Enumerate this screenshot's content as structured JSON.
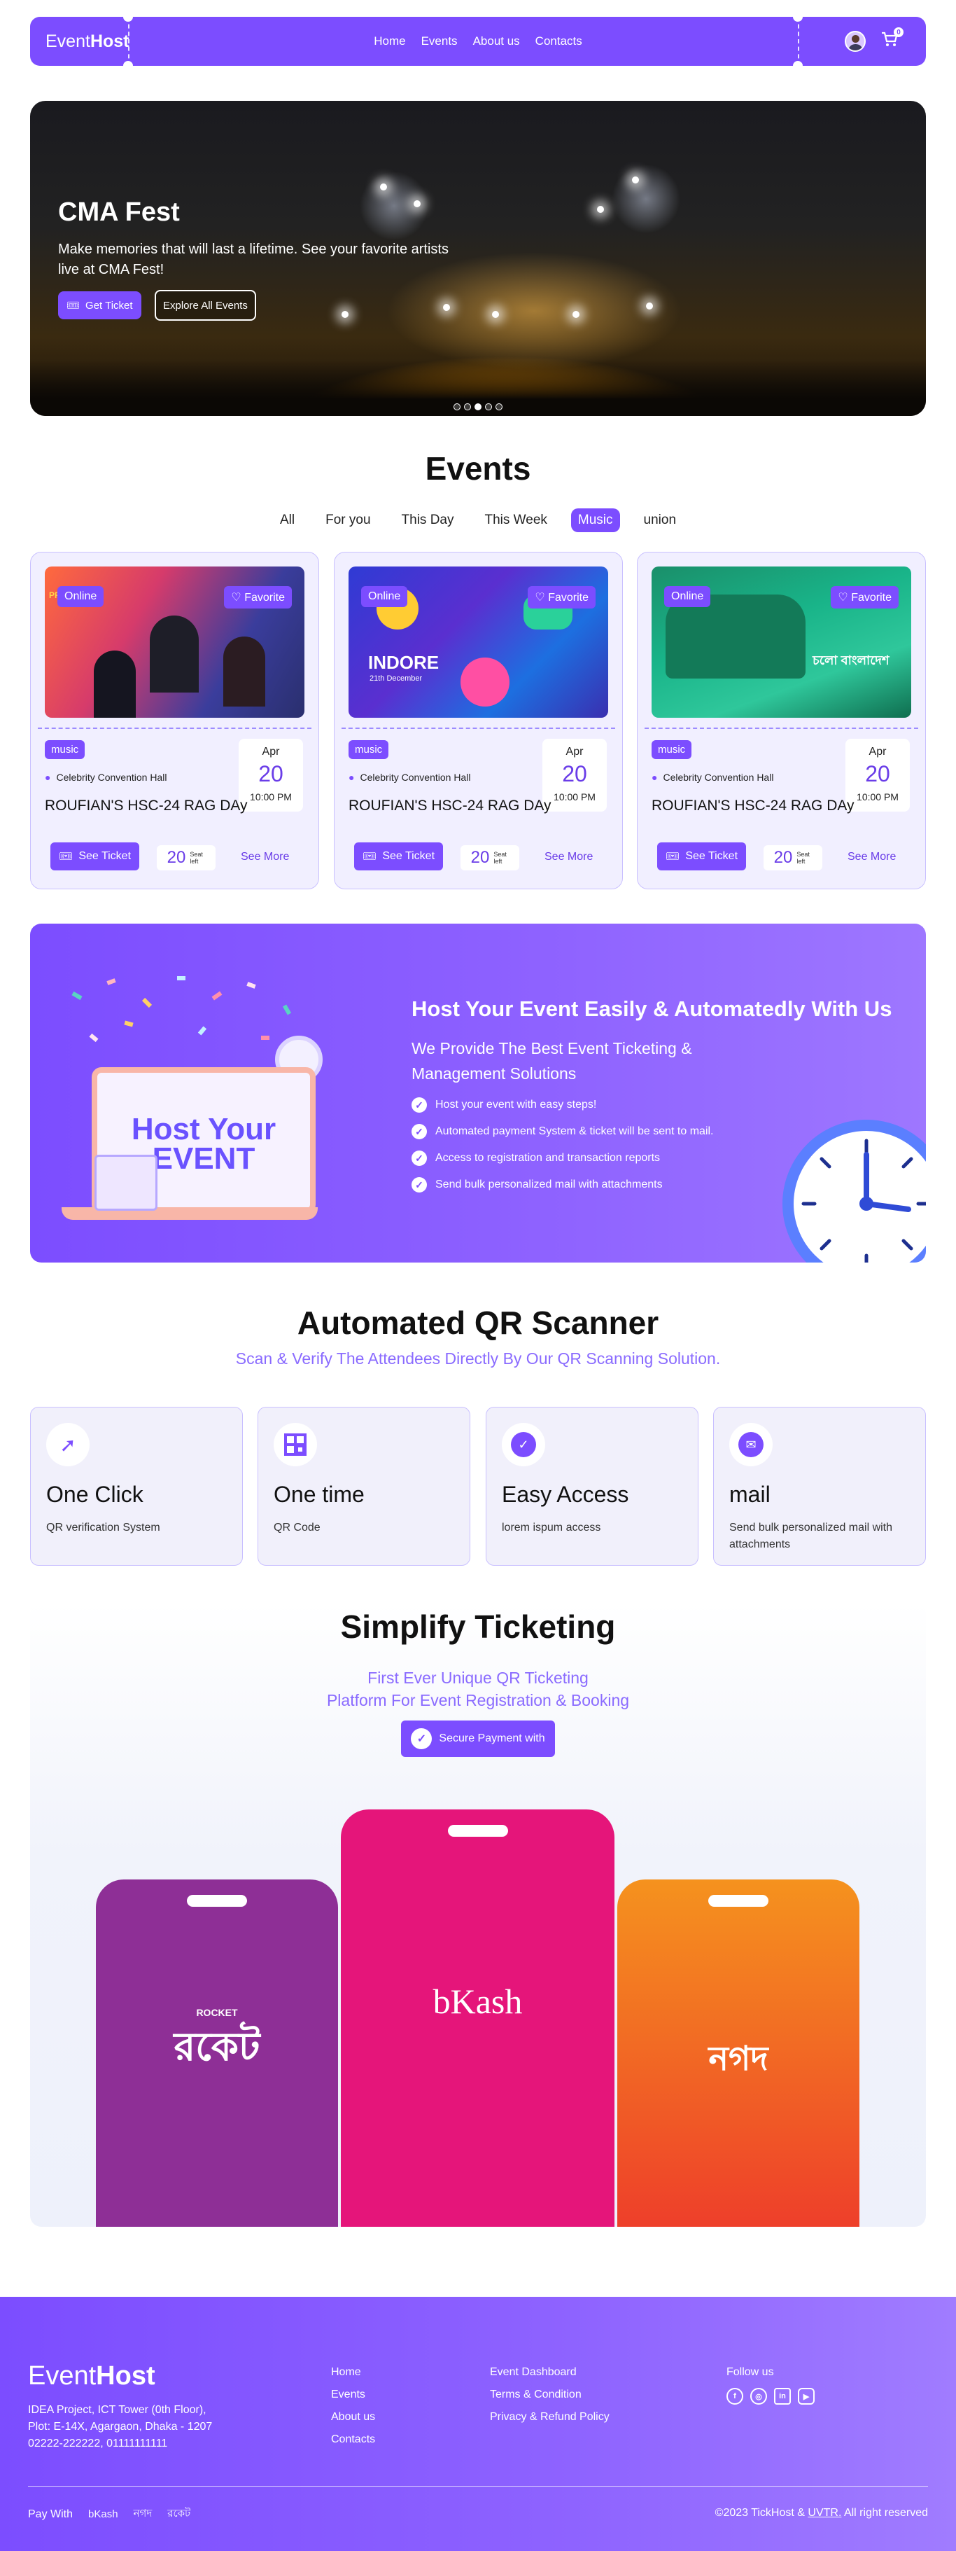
{
  "nav": {
    "brand_light": "Event",
    "brand_bold": "Host",
    "links": [
      "Home",
      "Events",
      "About us",
      "Contacts"
    ],
    "cart_count": "0"
  },
  "hero": {
    "title": "CMA Fest",
    "description": "Make memories that will last a lifetime. See your favorite artists live at CMA Fest!",
    "get_ticket_label": "Get Ticket",
    "explore_label": "Explore All Events",
    "slide_count": 5,
    "active_slide": 1
  },
  "events": {
    "heading": "Events",
    "filters": [
      "All",
      "For you",
      "This Day",
      "This Week",
      "Music",
      "union"
    ],
    "active_filter": "Music",
    "cards": [
      {
        "status": "Online",
        "favorite": "Favorite",
        "category": "music",
        "venue": "Celebrity Convention Hall",
        "month": "Apr",
        "day": "20",
        "time": "10:00 PM",
        "title": "ROUFIAN'S HSC-24 RAG DAy",
        "ticket_label": "See Ticket",
        "seats": "20",
        "seats_label": "Seat left",
        "more_label": "See More"
      },
      {
        "status": "Online",
        "favorite": "Favorite",
        "category": "music",
        "venue": "Celebrity Convention Hall",
        "month": "Apr",
        "day": "20",
        "time": "10:00 PM",
        "title": "ROUFIAN'S HSC-24 RAG DAy",
        "ticket_label": "See Ticket",
        "seats": "20",
        "seats_label": "Seat left",
        "more_label": "See More"
      },
      {
        "status": "Online",
        "favorite": "Favorite",
        "category": "music",
        "venue": "Celebrity Convention Hall",
        "month": "Apr",
        "day": "20",
        "time": "10:00 PM",
        "title": "ROUFIAN'S HSC-24 RAG DAy",
        "ticket_label": "See Ticket",
        "seats": "20",
        "seats_label": "Seat left",
        "more_label": "See More"
      }
    ],
    "poster_texts": {
      "poster1": "PRESENTS",
      "poster2_title": "INDORE",
      "poster2_date": "21th December",
      "poster3": "চলো বাংলাদেশ"
    }
  },
  "host": {
    "title": "Host Your Event Easily & Automatedly With Us",
    "subtitle": "We Provide The Best Event Ticketing & Management Solutions",
    "bullets": [
      "Host your event with easy steps!",
      "Automated payment System & ticket will be sent to mail.",
      "Access to registration and transaction reports",
      "Send bulk personalized mail with attachments"
    ],
    "illustration_text_1": "Host Your",
    "illustration_text_2": "EVENT"
  },
  "qr": {
    "heading": "Automated QR Scanner",
    "subtitle": "Scan & Verify The Attendees Directly By Our QR Scanning Solution.",
    "features": [
      {
        "icon": "cursor-click-icon",
        "title": "One Click",
        "desc": "QR verification System"
      },
      {
        "icon": "qr-code-icon",
        "title": "One time",
        "desc": "QR Code"
      },
      {
        "icon": "check-circle-icon",
        "title": "Easy Access",
        "desc": "lorem ispum access"
      },
      {
        "icon": "mail-icon",
        "title": "mail",
        "desc": "Send bulk personalized mail with attachments"
      }
    ]
  },
  "ticketing": {
    "heading": "Simplify Ticketing",
    "subtitle_1": "First Ever Unique  QR Ticketing",
    "subtitle_2": "Platform For Event Registration & Booking",
    "secure_label": "Secure Payment with",
    "providers": [
      {
        "name": "Rocket",
        "logo_text": "রকেট",
        "logo_top": "ROCKET",
        "color": "#8e2f96"
      },
      {
        "name": "bKash",
        "logo_text": "bKash",
        "color": "#e5157a"
      },
      {
        "name": "Nagad",
        "logo_text": "নগদ",
        "color": "#f2541b"
      }
    ]
  },
  "footer": {
    "brand_light": "Event",
    "brand_bold": "Host",
    "address_1": "IDEA Project, ICT Tower (0th Floor),",
    "address_2": "Plot: E-14X, Agargaon, Dhaka - 1207",
    "phones": "02222-222222, 01111111111",
    "links_col1": [
      "Home",
      "Events",
      "About us",
      "Contacts"
    ],
    "links_col2": [
      "Event Dashboard",
      "Terms & Condition",
      "Privacy & Refund Policy"
    ],
    "follow_label": "Follow us",
    "pay_label": "Pay With",
    "pay_logos": [
      "bKash",
      "নগদ",
      "রকেট"
    ],
    "copyright_prefix": "©2023 TickHost & ",
    "copyright_link": "UVTR.",
    "copyright_suffix": " All right reserved"
  },
  "colors": {
    "primary": "#7c4dff",
    "accent_text": "#8a6bff",
    "card_bg": "#f1efff",
    "card_border": "#c9c0ff"
  }
}
